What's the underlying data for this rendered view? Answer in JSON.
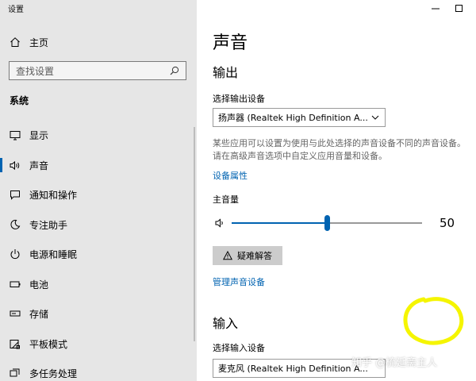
{
  "app": {
    "title": "设置"
  },
  "sidebar": {
    "home_label": "主页",
    "search_placeholder": "查找设置",
    "section_label": "系统",
    "items": [
      {
        "label": "显示",
        "icon": "monitor-icon"
      },
      {
        "label": "声音",
        "icon": "speaker-icon",
        "selected": true
      },
      {
        "label": "通知和操作",
        "icon": "notification-icon"
      },
      {
        "label": "专注助手",
        "icon": "moon-icon"
      },
      {
        "label": "电源和睡眠",
        "icon": "power-icon"
      },
      {
        "label": "电池",
        "icon": "battery-icon"
      },
      {
        "label": "存储",
        "icon": "storage-icon"
      },
      {
        "label": "平板模式",
        "icon": "tablet-icon"
      },
      {
        "label": "多任务处理",
        "icon": "multitask-icon"
      }
    ]
  },
  "main": {
    "page_title": "声音",
    "output": {
      "heading": "输出",
      "select_label": "选择输出设备",
      "device": "扬声器 (Realtek High Definition A...",
      "description": "某些应用可以设置为使用与此处选择的声音设备不同的声音设备。请在高级声音选项中自定义应用音量和设备。",
      "device_properties_link": "设备属性",
      "master_volume_label": "主音量",
      "volume": 50,
      "volume_text": "50",
      "troubleshoot_label": "疑难解答",
      "manage_link": "管理声音设备"
    },
    "input": {
      "heading": "输入",
      "select_label": "选择输入设备",
      "device": "麦克风 (Realtek High Definition A..."
    }
  },
  "watermark": "知乎 @梳延斋主人",
  "colors": {
    "sidebar_bg": "#e6e6e6",
    "accent": "#0063b1",
    "highlight": "#f5f500",
    "button_bg": "#cccccc"
  }
}
